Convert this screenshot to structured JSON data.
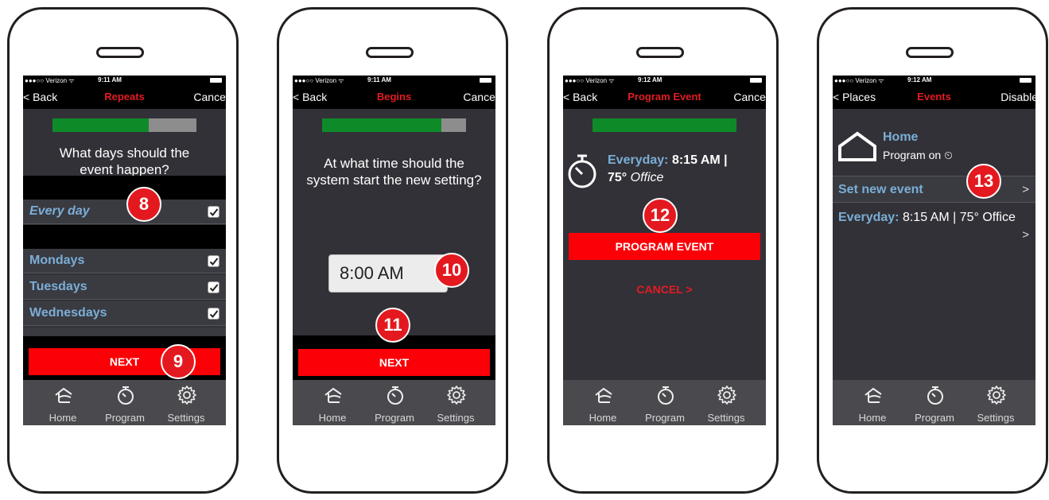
{
  "status": {
    "carrier": "●●●○○ Verizon ᯤ",
    "time1": "9:11 AM",
    "time2": "9:12 AM"
  },
  "tabs": {
    "home": "Home",
    "program": "Program",
    "settings": "Settings"
  },
  "screen1": {
    "back": "< Back",
    "title": "Repeats",
    "cancel": "Cancel",
    "progress": 0.67,
    "question": "What days should the event happen?",
    "every_day": "Every day",
    "days": [
      "Mondays",
      "Tuesdays",
      "Wednesdays"
    ],
    "next": "NEXT",
    "badge_a": "8",
    "badge_b": "9"
  },
  "screen2": {
    "back": "< Back",
    "title": "Begins",
    "cancel": "Cancel",
    "progress": 0.83,
    "question": "At what time should the system start the new setting?",
    "time_value": "8:00 AM",
    "next": "NEXT",
    "badge_a": "10",
    "badge_b": "11"
  },
  "screen3": {
    "back": "< Back",
    "title": "Program Event",
    "cancel": "Cancel",
    "progress": 1.0,
    "summary_prefix": "Everyday:",
    "summary_time": "8:15 AM |",
    "summary_temp": "75°",
    "summary_place": "Office",
    "program_btn": "PROGRAM EVENT",
    "cancel_link": "CANCEL >",
    "badge": "12"
  },
  "screen4": {
    "back": "< Places",
    "title": "Events",
    "right": "Disable",
    "home_name": "Home",
    "home_sub": "Program on ⏲",
    "set_new_event": "Set new event",
    "arrow": ">",
    "event_prefix": "Everyday:",
    "event_text": "8:15 AM | 75° Office",
    "badge": "13"
  },
  "colors": {
    "accent_red": "#fb0007",
    "progress_green": "#0f8a28",
    "label_blue": "#7aaed6",
    "screen_bg": "#323137"
  }
}
